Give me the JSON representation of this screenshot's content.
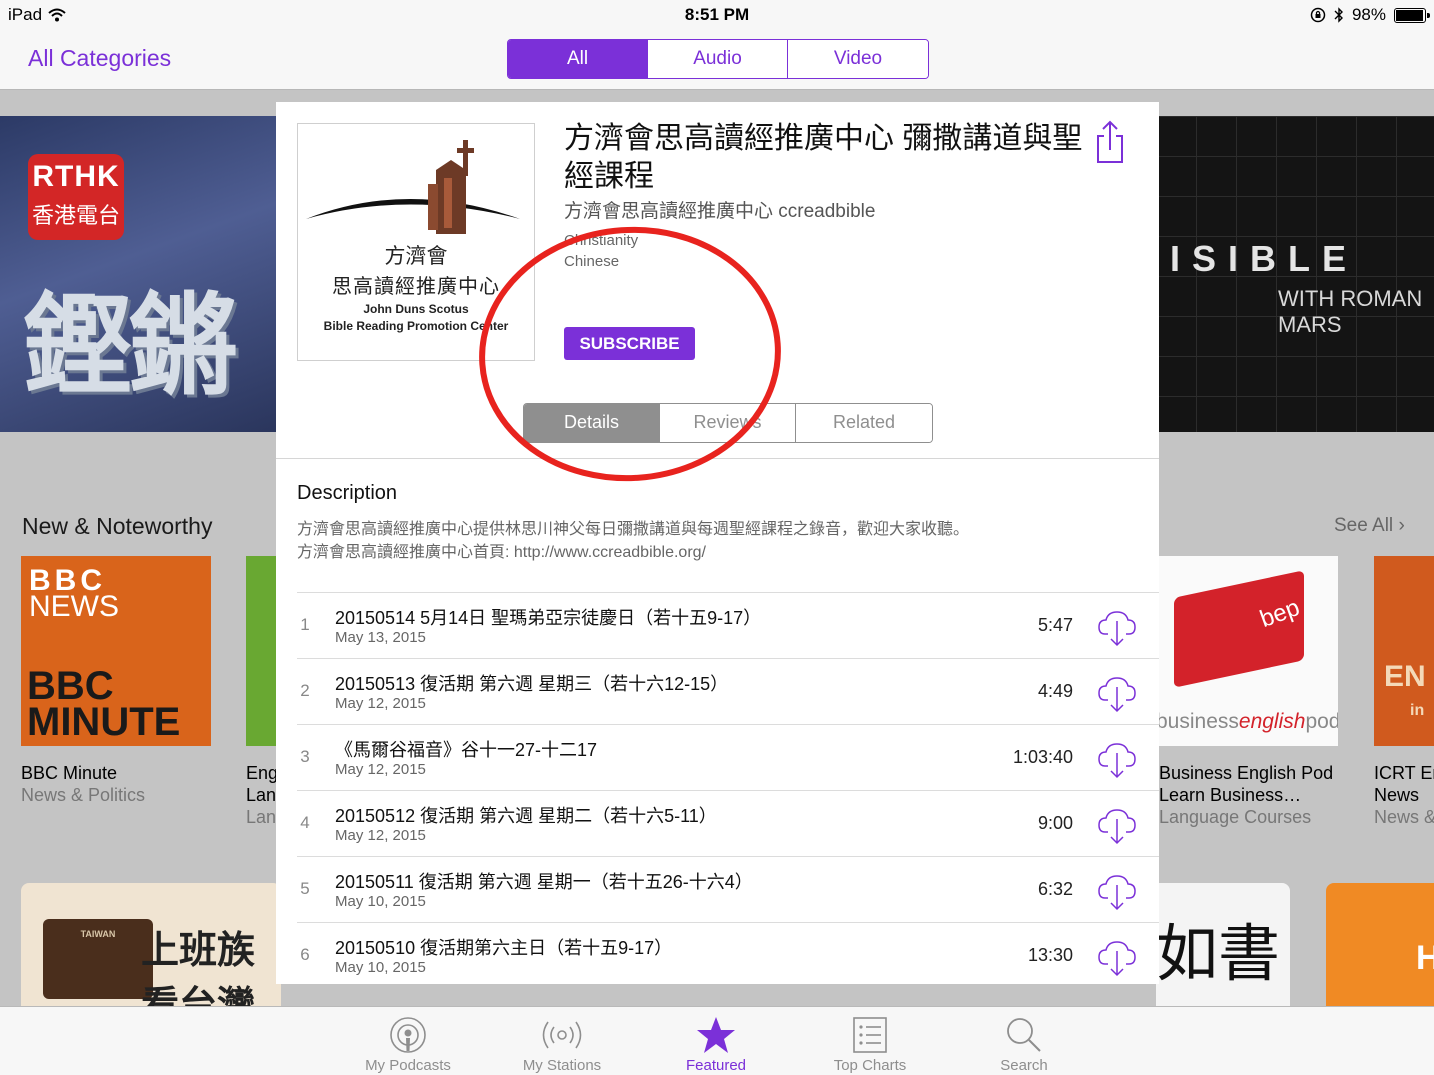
{
  "status_bar": {
    "device": "iPad",
    "time": "8:51 PM",
    "battery": "98%",
    "battery_level": 0.98
  },
  "nav": {
    "back_label": "All Categories",
    "segments": [
      "All",
      "Audio",
      "Video"
    ],
    "active_segment": 0
  },
  "background": {
    "banner_left": {
      "logo_line1": "RTHK",
      "logo_line2": "香港電台",
      "title": "鏗鏘集"
    },
    "banner_right": {
      "title": "ISIBLE",
      "subtitle": "WITH ROMAN MARS"
    },
    "section_title": "New & Noteworthy",
    "see_all": "See All",
    "tiles": [
      {
        "art_line1": "BBC",
        "art_line2": "NEWS",
        "art_line3": "BBC",
        "art_line4": "MINUTE",
        "title": "BBC Minute",
        "subtitle": "News & Politics"
      },
      {
        "title": "Eng",
        "title2": "Lan",
        "subtitle": "Lan"
      },
      {
        "art_word": "bep",
        "art_pod_a": "business",
        "art_pod_b": "english",
        "art_pod_c": "pod",
        "title": "Business English Pod",
        "title2": "Learn Business…",
        "subtitle": "Language Courses"
      },
      {
        "art_line1": "EN",
        "art_line2": "in",
        "title": "ICRT En",
        "title2": "News",
        "subtitle": "News &"
      }
    ],
    "row2": {
      "tile_a_text": "上班族看台灣",
      "tile_a_case": "TAIWAN",
      "tile_b_text": "如書",
      "tile_c_text": "H"
    }
  },
  "podcast": {
    "artwork": {
      "line_cn1": "方濟會",
      "line_cn2": "思高讀經推廣中心",
      "line_en1": "John Duns Scotus",
      "line_en2": "Bible Reading Promotion Center"
    },
    "title": "方濟會思高讀經推廣中心 彌撒講道與聖經課程",
    "author": "方濟會思高讀經推廣中心 ccreadbible",
    "category": "Christianity",
    "language": "Chinese",
    "subscribe_label": "SUBSCRIBE",
    "detail_tabs": [
      "Details",
      "Reviews",
      "Related"
    ],
    "active_detail_tab": 0,
    "description_heading": "Description",
    "description_lines": [
      "方濟會思高讀經推廣中心提供林思川神父每日彌撒講道與每週聖經課程之錄音，歡迎大家收聽。",
      "方濟會思高讀經推廣中心首頁: http://www.ccreadbible.org/"
    ],
    "episodes": [
      {
        "num": "1",
        "title": "20150514 5月14日 聖瑪弟亞宗徒慶日（若十五9-17）",
        "date": "May 13, 2015",
        "duration": "5:47"
      },
      {
        "num": "2",
        "title": "20150513 復活期 第六週 星期三（若十六12-15）",
        "date": "May 12, 2015",
        "duration": "4:49"
      },
      {
        "num": "3",
        "title": "《馬爾谷福音》谷十一27-十二17",
        "date": "May 12, 2015",
        "duration": "1:03:40"
      },
      {
        "num": "4",
        "title": "20150512 復活期 第六週 星期二（若十六5-11）",
        "date": "May 12, 2015",
        "duration": "9:00"
      },
      {
        "num": "5",
        "title": "20150511 復活期 第六週 星期一（若十五26-十六4）",
        "date": "May 10, 2015",
        "duration": "6:32"
      },
      {
        "num": "6",
        "title": "20150510 復活期第六主日（若十五9-17）",
        "date": "May 10, 2015",
        "duration": "13:30"
      }
    ]
  },
  "tab_bar": {
    "items": [
      {
        "label": "My Podcasts",
        "icon": "podcast-icon"
      },
      {
        "label": "My Stations",
        "icon": "stations-icon"
      },
      {
        "label": "Featured",
        "icon": "star-icon"
      },
      {
        "label": "Top Charts",
        "icon": "list-icon"
      },
      {
        "label": "Search",
        "icon": "search-icon"
      }
    ],
    "active": 2
  },
  "colors": {
    "accent": "#7b30d8",
    "annotation": "#e8231e"
  }
}
